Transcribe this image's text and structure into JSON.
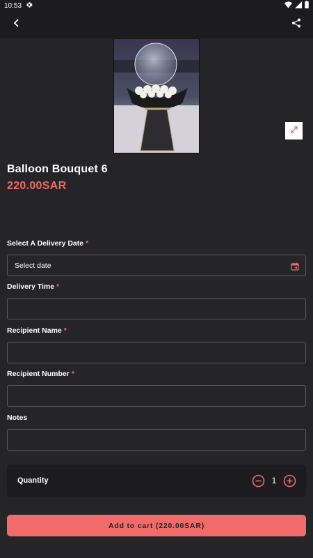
{
  "status_bar": {
    "time": "10:53"
  },
  "product": {
    "title": "Balloon Bouquet 6",
    "price": "220.00SAR"
  },
  "form": {
    "delivery_date": {
      "label": "Select A Delivery Date",
      "required_mark": "*",
      "value": "Select date"
    },
    "delivery_time": {
      "label": "Delivery Time",
      "required_mark": "*",
      "value": ""
    },
    "recipient_name": {
      "label": "Recipient Name",
      "required_mark": "*",
      "value": ""
    },
    "recipient_number": {
      "label": "Recipient Number",
      "required_mark": "*",
      "value": ""
    },
    "notes": {
      "label": "Notes",
      "value": ""
    }
  },
  "quantity": {
    "label": "Quantity",
    "value": "1"
  },
  "add_to_cart": {
    "label": "Add to cart (220.00SAR)"
  },
  "colors": {
    "background": "#252528",
    "bar": "#1c1c1f",
    "accent": "#f26b6b",
    "field_border": "#5c5c60"
  },
  "icons": [
    "settings-icon",
    "wifi-icon",
    "signal-icon",
    "battery-icon",
    "back-arrow-icon",
    "share-icon",
    "expand-icon",
    "calendar-icon",
    "minus-circle-icon",
    "plus-circle-icon"
  ]
}
